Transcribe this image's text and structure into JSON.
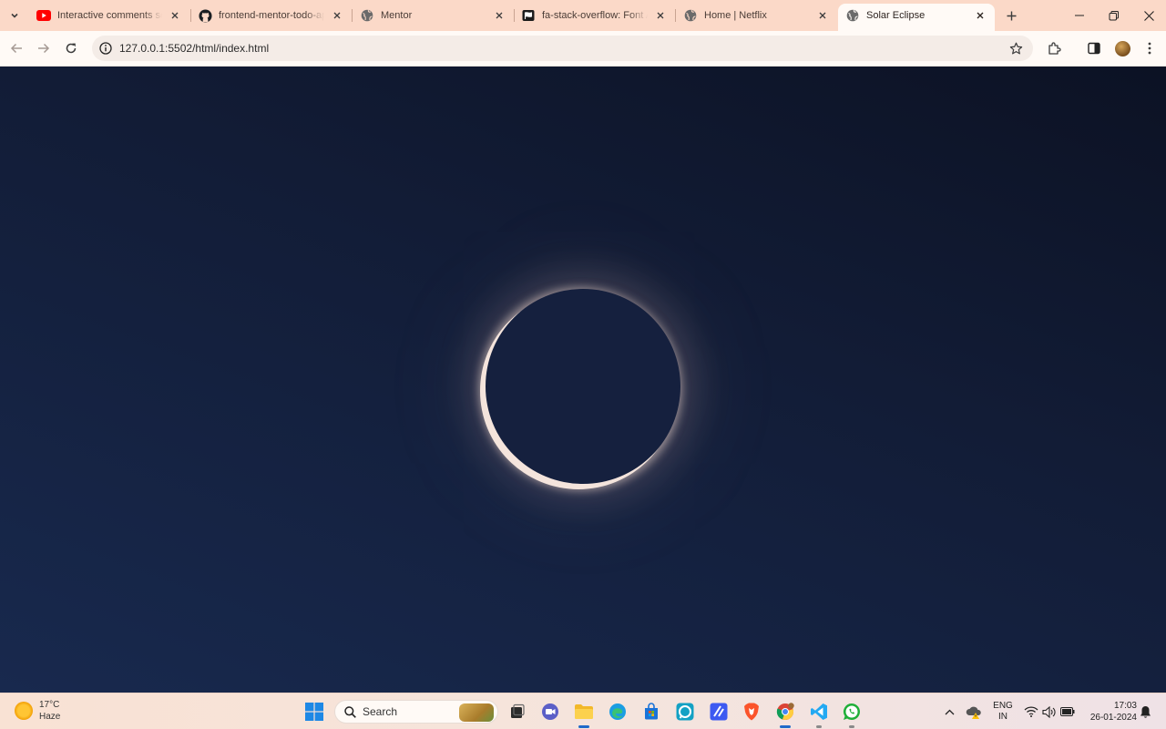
{
  "browser": {
    "tabs": [
      {
        "title": "Interactive comments secti",
        "favicon": "youtube-icon"
      },
      {
        "title": "frontend-mentor-todo-app",
        "favicon": "github-icon"
      },
      {
        "title": "Mentor",
        "favicon": "globe-icon"
      },
      {
        "title": "fa-stack-overflow: Font Aw",
        "favicon": "font-awesome-icon"
      },
      {
        "title": "Home | Netflix",
        "favicon": "globe-icon"
      },
      {
        "title": "Solar Eclipse",
        "favicon": "globe-icon",
        "active": true
      }
    ],
    "address": "127.0.0.1:5502/html/index.html"
  },
  "page": {
    "background_top": "#0c1224",
    "background_bottom": "#18294e",
    "corona_color": "#f4e4dc",
    "moon_color": "#15203e"
  },
  "taskbar": {
    "weather": {
      "temp": "17°C",
      "condition": "Haze"
    },
    "search_label": "Search",
    "apps": [
      "start-icon",
      "task-view-icon",
      "meet-icon",
      "file-explorer-icon",
      "edge-icon",
      "store-icon",
      "alexa-icon",
      "pen-app-icon",
      "brave-icon",
      "chrome-icon",
      "vscode-icon",
      "whatsapp-icon"
    ],
    "lang_top": "ENG",
    "lang_bottom": "IN",
    "time": "17:03",
    "date": "26-01-2024"
  }
}
